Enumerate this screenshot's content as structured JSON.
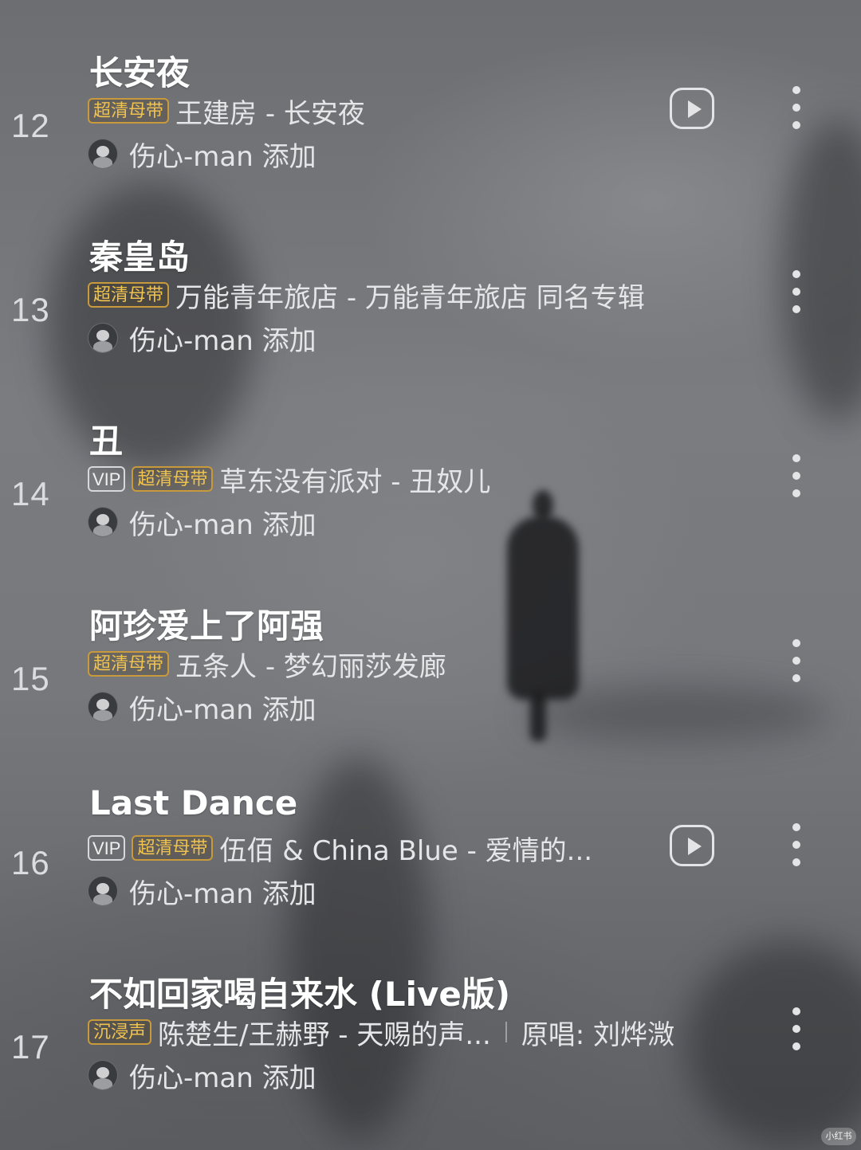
{
  "songs": [
    {
      "index": "12",
      "title": "长安夜",
      "badges": [
        "超清母带"
      ],
      "info": "王建房 - 长安夜",
      "added_by": "伤心-man 添加",
      "has_play": true
    },
    {
      "index": "13",
      "title": "秦皇岛",
      "badges": [
        "超清母带"
      ],
      "info": "万能青年旅店 - 万能青年旅店 同名专辑",
      "added_by": "伤心-man 添加",
      "has_play": false
    },
    {
      "index": "14",
      "title": "丑",
      "badges": [
        "VIP",
        "超清母带"
      ],
      "info": "草东没有派对 - 丑奴儿",
      "added_by": "伤心-man 添加",
      "has_play": false
    },
    {
      "index": "15",
      "title": "阿珍爱上了阿强",
      "badges": [
        "超清母带"
      ],
      "info": "五条人 - 梦幻丽莎发廊",
      "added_by": "伤心-man 添加",
      "has_play": false
    },
    {
      "index": "16",
      "title": "Last Dance",
      "badges": [
        "VIP",
        "超清母带"
      ],
      "info": "伍佰 & China Blue - 爱情的...",
      "added_by": "伤心-man 添加",
      "has_play": true
    },
    {
      "index": "17",
      "title": "不如回家喝自来水 (Live版)",
      "badges": [
        "沉浸声"
      ],
      "info": "陈楚生/王赫野 - 天赐的声...",
      "original_singer": "原唱: 刘烨溦",
      "added_by": "伤心-man 添加",
      "has_play": false
    }
  ],
  "icons": {
    "play": "play-video-icon",
    "more": "more-vertical-icon",
    "avatar": "user-avatar"
  },
  "colors": {
    "badge_gold": "#f0c24f",
    "text_primary": "#ffffff",
    "text_secondary": "#e6e6e8"
  },
  "watermark": "小红书"
}
